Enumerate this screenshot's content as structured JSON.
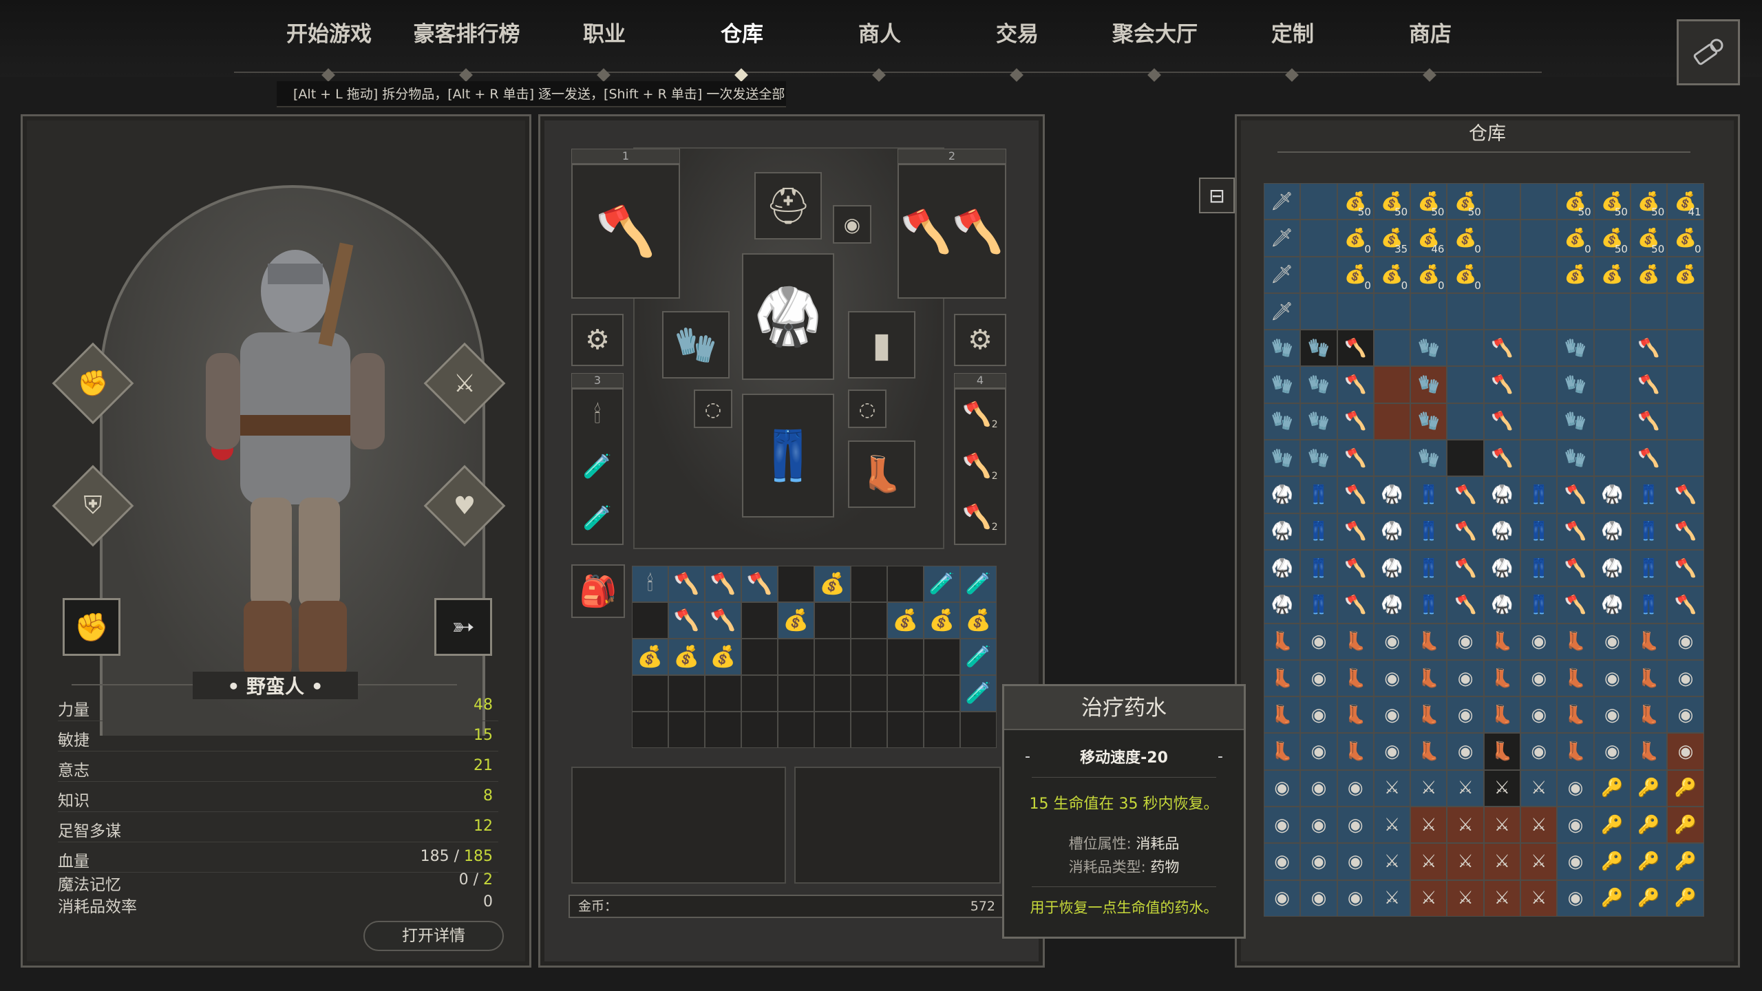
{
  "nav": {
    "tabs": [
      "开始游戏",
      "豪客排行榜",
      "职业",
      "仓库",
      "商人",
      "交易",
      "聚会大厅",
      "定制",
      "商店"
    ],
    "active": "仓库"
  },
  "hint": "[Alt + L 拖动] 拆分物品，[Alt + R 单击] 逐一发送，[Shift + R 单击] 一次发送全部",
  "character": {
    "class_name": "野蛮人",
    "stats": [
      {
        "name": "力量",
        "value": "48"
      },
      {
        "name": "敏捷",
        "value": "15"
      },
      {
        "name": "意志",
        "value": "21"
      },
      {
        "name": "知识",
        "value": "8"
      },
      {
        "name": "足智多谋",
        "value": "12"
      }
    ],
    "hp_label": "血量",
    "hp_current": "185",
    "hp_sep": "/",
    "hp_max": "185",
    "mem_label": "魔法记忆",
    "mem_current": "0",
    "mem_sep": "/",
    "mem_max": "2",
    "eff_label": "消耗品效率",
    "eff_value": "0",
    "details_button": "打开详情"
  },
  "equipment": {
    "slot_labels": [
      "1",
      "2",
      "3",
      "4"
    ],
    "gold_label": "金币：",
    "gold_value": "572",
    "counts": {
      "throw_1": "2",
      "throw_2": "2",
      "throw_3": "2"
    }
  },
  "tooltip": {
    "title": "治疗药水",
    "dash": "-",
    "stat": "移动速度-20",
    "effect": "15 生命值在 35 秒内恢复。",
    "slot_label": "槽位属性:",
    "slot_value": "消耗品",
    "type_label": "消耗品类型:",
    "type_value": "药物",
    "description": "用于恢复一点生命值的药水。"
  },
  "warehouse": {
    "title": "仓库",
    "bag_counts": [
      "50",
      "50",
      "50",
      "50",
      "50",
      "50",
      "50",
      "41",
      "0",
      "35",
      "46",
      "0",
      "0",
      "50",
      "50",
      "0",
      "0",
      "0",
      "0",
      "0"
    ]
  },
  "colors": {
    "accent_green": "#c7d93a",
    "stash_blue": "#2e4d66",
    "stash_red": "#6b3524"
  }
}
